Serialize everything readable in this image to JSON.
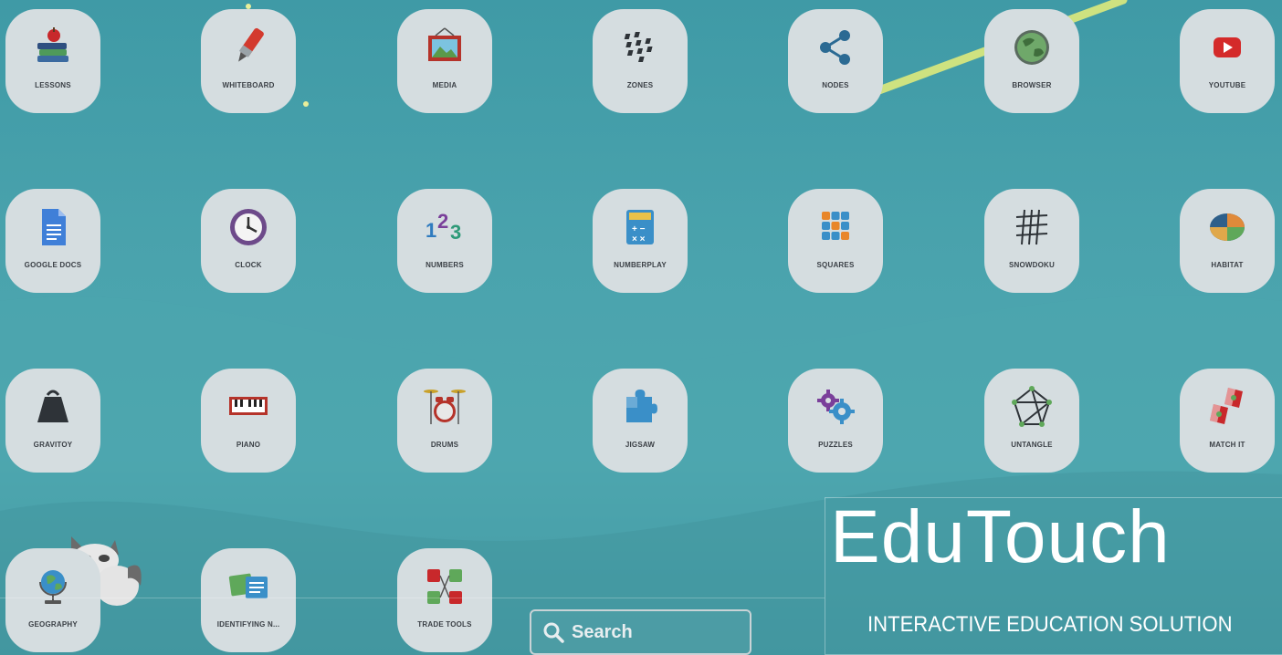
{
  "apps": [
    {
      "label": "LESSONS",
      "icon": "books-apple-icon"
    },
    {
      "label": "WHITEBOARD",
      "icon": "marker-icon"
    },
    {
      "label": "MEDIA",
      "icon": "picture-frame-icon"
    },
    {
      "label": "ZONES",
      "icon": "zones-icon"
    },
    {
      "label": "NODES",
      "icon": "share-nodes-icon"
    },
    {
      "label": "BROWSER",
      "icon": "globe-icon"
    },
    {
      "label": "YOUTUBE",
      "icon": "youtube-icon"
    },
    {
      "label": "GOOGLE DOCS",
      "icon": "google-docs-icon"
    },
    {
      "label": "CLOCK",
      "icon": "clock-icon"
    },
    {
      "label": "NUMBERS",
      "icon": "numbers-123-icon"
    },
    {
      "label": "NUMBERPLAY",
      "icon": "calculator-icon"
    },
    {
      "label": "SQUARES",
      "icon": "number-squares-icon"
    },
    {
      "label": "SNOWDOKU",
      "icon": "grid-hash-icon"
    },
    {
      "label": "HABITAT",
      "icon": "habitat-pie-icon"
    },
    {
      "label": "GRAVITOY",
      "icon": "weight-icon"
    },
    {
      "label": "PIANO",
      "icon": "piano-icon"
    },
    {
      "label": "DRUMS",
      "icon": "drum-kit-icon"
    },
    {
      "label": "JIGSAW",
      "icon": "puzzle-piece-icon"
    },
    {
      "label": "PUZZLES",
      "icon": "gears-icon"
    },
    {
      "label": "UNTANGLE",
      "icon": "untangle-graph-icon"
    },
    {
      "label": "MATCH IT",
      "icon": "match-cards-icon"
    },
    {
      "label": "GEOGRAPHY",
      "icon": "desk-globe-icon"
    },
    {
      "label": "IDENTIFYING N...",
      "icon": "image-cards-icon"
    },
    {
      "label": "TRADE TOOLS",
      "icon": "trade-tools-icon"
    }
  ],
  "search": {
    "label": "Search",
    "icon": "search-icon"
  },
  "brand": {
    "title": "EduTouch",
    "subtitle": "INTERACTIVE EDUCATION SOLUTION"
  },
  "colors": {
    "background": "#4aa3ad",
    "tile": "#d8dfe2",
    "label": "#3a3f45"
  }
}
